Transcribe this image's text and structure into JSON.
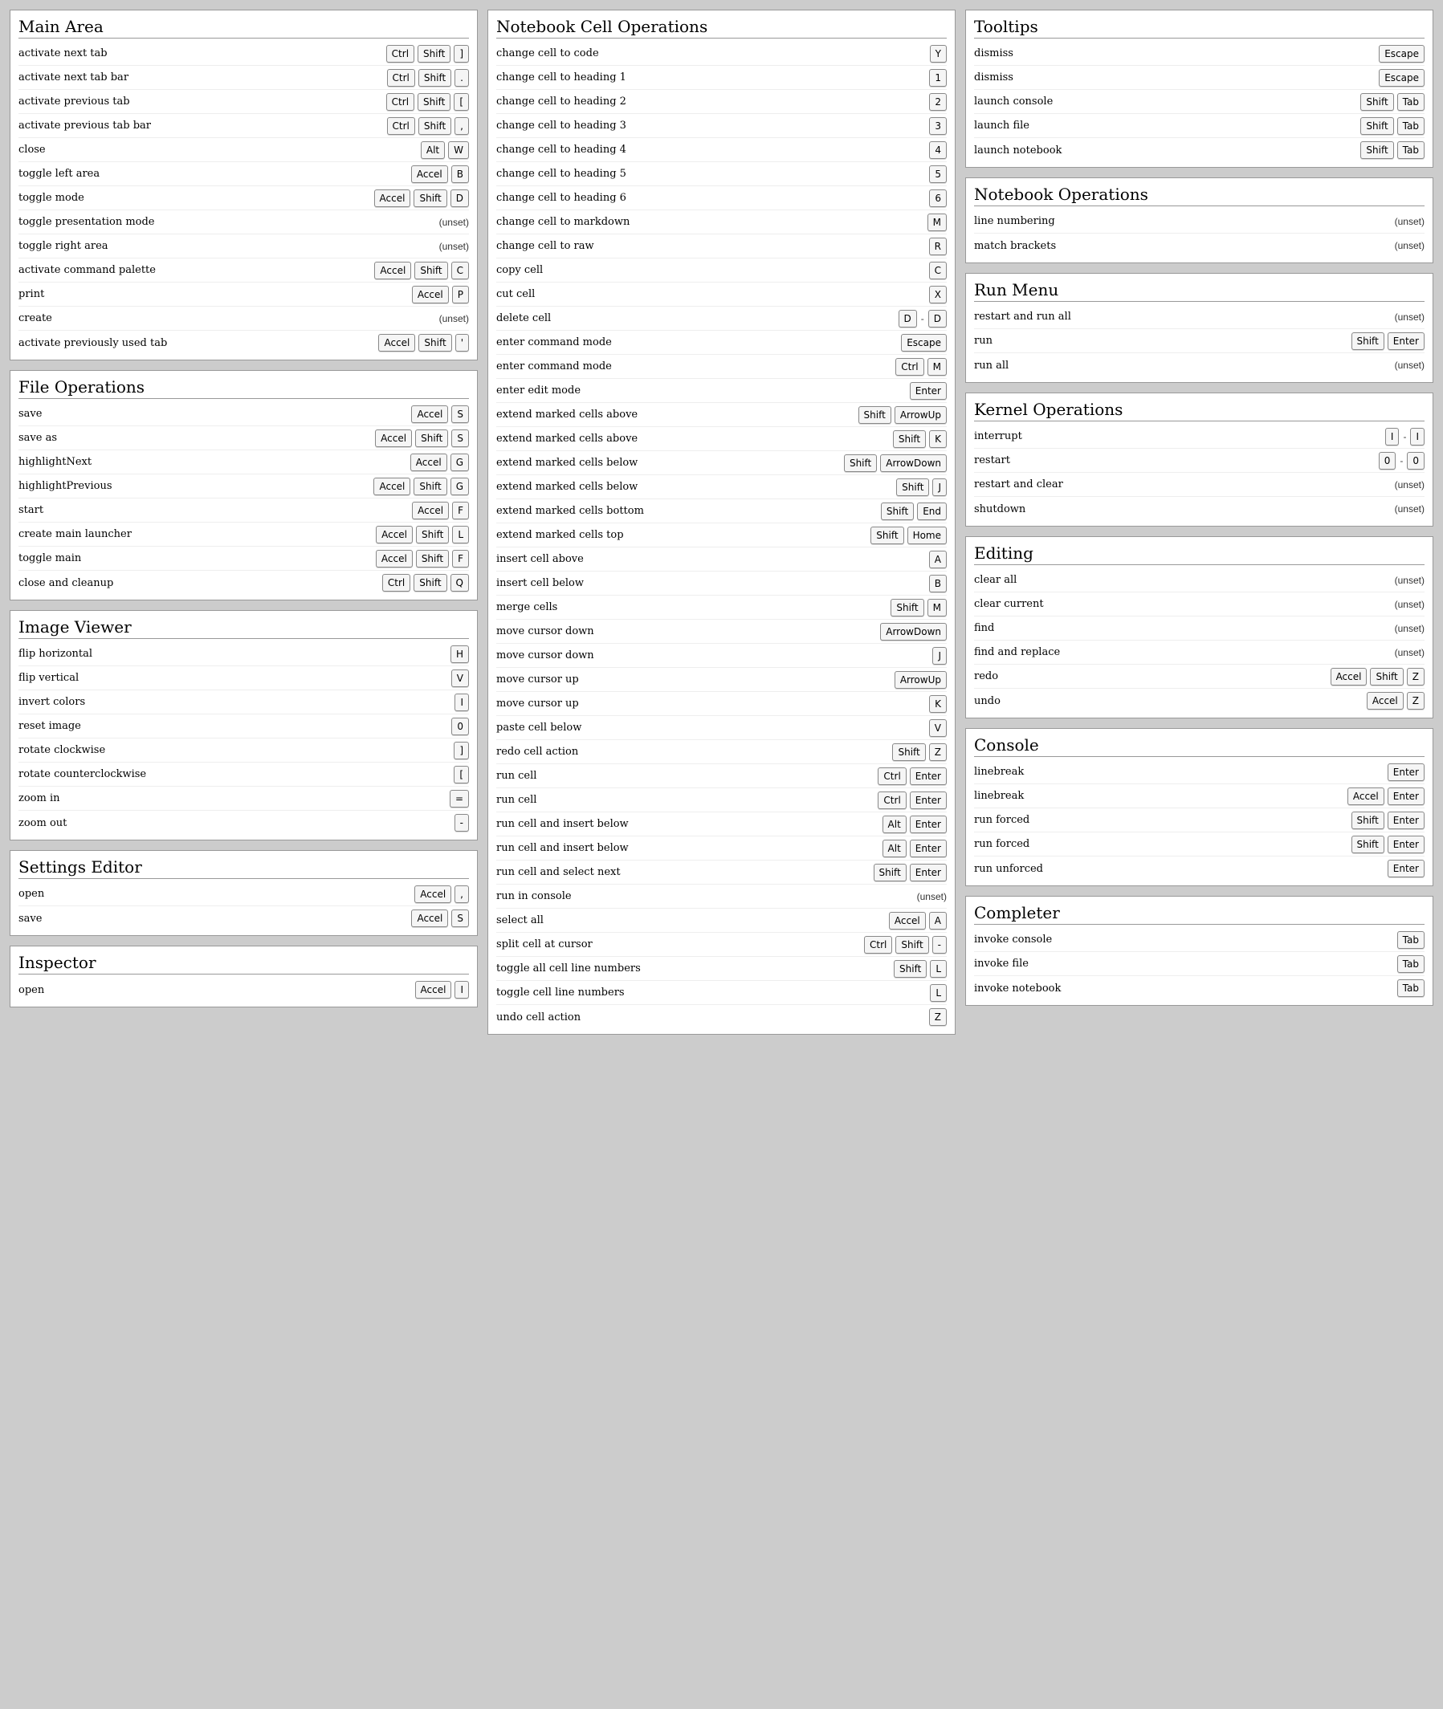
{
  "unset_label": "(unset)",
  "columns": [
    [
      {
        "title": "Main Area",
        "rows": [
          {
            "label": "activate next tab",
            "keys": [
              [
                "Ctrl",
                "Shift",
                "]"
              ]
            ]
          },
          {
            "label": "activate next tab bar",
            "keys": [
              [
                "Ctrl",
                "Shift",
                "."
              ]
            ]
          },
          {
            "label": "activate previous tab",
            "keys": [
              [
                "Ctrl",
                "Shift",
                "["
              ]
            ]
          },
          {
            "label": "activate previous tab bar",
            "keys": [
              [
                "Ctrl",
                "Shift",
                ","
              ]
            ]
          },
          {
            "label": "close",
            "keys": [
              [
                "Alt",
                "W"
              ]
            ]
          },
          {
            "label": "toggle left area",
            "keys": [
              [
                "Accel",
                "B"
              ]
            ]
          },
          {
            "label": "toggle mode",
            "keys": [
              [
                "Accel",
                "Shift",
                "D"
              ]
            ]
          },
          {
            "label": "toggle presentation mode",
            "unset": true
          },
          {
            "label": "toggle right area",
            "unset": true
          },
          {
            "label": "activate command palette",
            "keys": [
              [
                "Accel",
                "Shift",
                "C"
              ]
            ]
          },
          {
            "label": "print",
            "keys": [
              [
                "Accel",
                "P"
              ]
            ]
          },
          {
            "label": "create",
            "unset": true
          },
          {
            "label": "activate previously used tab",
            "keys": [
              [
                "Accel",
                "Shift",
                "'"
              ]
            ]
          }
        ]
      },
      {
        "title": "File Operations",
        "rows": [
          {
            "label": "save",
            "keys": [
              [
                "Accel",
                "S"
              ]
            ]
          },
          {
            "label": "save as",
            "keys": [
              [
                "Accel",
                "Shift",
                "S"
              ]
            ]
          },
          {
            "label": "highlightNext",
            "keys": [
              [
                "Accel",
                "G"
              ]
            ]
          },
          {
            "label": "highlightPrevious",
            "keys": [
              [
                "Accel",
                "Shift",
                "G"
              ]
            ]
          },
          {
            "label": "start",
            "keys": [
              [
                "Accel",
                "F"
              ]
            ]
          },
          {
            "label": "create main launcher",
            "keys": [
              [
                "Accel",
                "Shift",
                "L"
              ]
            ]
          },
          {
            "label": "toggle main",
            "keys": [
              [
                "Accel",
                "Shift",
                "F"
              ]
            ]
          },
          {
            "label": "close and cleanup",
            "keys": [
              [
                "Ctrl",
                "Shift",
                "Q"
              ]
            ]
          }
        ]
      },
      {
        "title": "Image Viewer",
        "rows": [
          {
            "label": "flip horizontal",
            "keys": [
              [
                "H"
              ]
            ]
          },
          {
            "label": "flip vertical",
            "keys": [
              [
                "V"
              ]
            ]
          },
          {
            "label": "invert colors",
            "keys": [
              [
                "I"
              ]
            ]
          },
          {
            "label": "reset image",
            "keys": [
              [
                "0"
              ]
            ]
          },
          {
            "label": "rotate clockwise",
            "keys": [
              [
                "]"
              ]
            ]
          },
          {
            "label": "rotate counterclockwise",
            "keys": [
              [
                "["
              ]
            ]
          },
          {
            "label": "zoom in",
            "keys": [
              [
                "="
              ]
            ]
          },
          {
            "label": "zoom out",
            "keys": [
              [
                "-"
              ]
            ]
          }
        ]
      },
      {
        "title": "Settings Editor",
        "rows": [
          {
            "label": "open",
            "keys": [
              [
                "Accel",
                ","
              ]
            ]
          },
          {
            "label": "save",
            "keys": [
              [
                "Accel",
                "S"
              ]
            ]
          }
        ]
      },
      {
        "title": "Inspector",
        "rows": [
          {
            "label": "open",
            "keys": [
              [
                "Accel",
                "I"
              ]
            ]
          }
        ]
      }
    ],
    [
      {
        "title": "Notebook Cell Operations",
        "rows": [
          {
            "label": "change cell to code",
            "keys": [
              [
                "Y"
              ]
            ]
          },
          {
            "label": "change cell to heading 1",
            "keys": [
              [
                "1"
              ]
            ]
          },
          {
            "label": "change cell to heading 2",
            "keys": [
              [
                "2"
              ]
            ]
          },
          {
            "label": "change cell to heading 3",
            "keys": [
              [
                "3"
              ]
            ]
          },
          {
            "label": "change cell to heading 4",
            "keys": [
              [
                "4"
              ]
            ]
          },
          {
            "label": "change cell to heading 5",
            "keys": [
              [
                "5"
              ]
            ]
          },
          {
            "label": "change cell to heading 6",
            "keys": [
              [
                "6"
              ]
            ]
          },
          {
            "label": "change cell to markdown",
            "keys": [
              [
                "M"
              ]
            ]
          },
          {
            "label": "change cell to raw",
            "keys": [
              [
                "R"
              ]
            ]
          },
          {
            "label": "copy cell",
            "keys": [
              [
                "C"
              ]
            ]
          },
          {
            "label": "cut cell",
            "keys": [
              [
                "X"
              ]
            ]
          },
          {
            "label": "delete cell",
            "keys": [
              [
                "D"
              ],
              [
                "D"
              ]
            ]
          },
          {
            "label": "enter command mode",
            "keys": [
              [
                "Escape"
              ]
            ]
          },
          {
            "label": "enter command mode",
            "keys": [
              [
                "Ctrl",
                "M"
              ]
            ]
          },
          {
            "label": "enter edit mode",
            "keys": [
              [
                "Enter"
              ]
            ]
          },
          {
            "label": "extend marked cells above",
            "keys": [
              [
                "Shift",
                "ArrowUp"
              ]
            ]
          },
          {
            "label": "extend marked cells above",
            "keys": [
              [
                "Shift",
                "K"
              ]
            ]
          },
          {
            "label": "extend marked cells below",
            "keys": [
              [
                "Shift",
                "ArrowDown"
              ]
            ]
          },
          {
            "label": "extend marked cells below",
            "keys": [
              [
                "Shift",
                "J"
              ]
            ]
          },
          {
            "label": "extend marked cells bottom",
            "keys": [
              [
                "Shift",
                "End"
              ]
            ]
          },
          {
            "label": "extend marked cells top",
            "keys": [
              [
                "Shift",
                "Home"
              ]
            ]
          },
          {
            "label": "insert cell above",
            "keys": [
              [
                "A"
              ]
            ]
          },
          {
            "label": "insert cell below",
            "keys": [
              [
                "B"
              ]
            ]
          },
          {
            "label": "merge cells",
            "keys": [
              [
                "Shift",
                "M"
              ]
            ]
          },
          {
            "label": "move cursor down",
            "keys": [
              [
                "ArrowDown"
              ]
            ]
          },
          {
            "label": "move cursor down",
            "keys": [
              [
                "J"
              ]
            ]
          },
          {
            "label": "move cursor up",
            "keys": [
              [
                "ArrowUp"
              ]
            ]
          },
          {
            "label": "move cursor up",
            "keys": [
              [
                "K"
              ]
            ]
          },
          {
            "label": "paste cell below",
            "keys": [
              [
                "V"
              ]
            ]
          },
          {
            "label": "redo cell action",
            "keys": [
              [
                "Shift",
                "Z"
              ]
            ]
          },
          {
            "label": "run cell",
            "keys": [
              [
                "Ctrl",
                "Enter"
              ]
            ]
          },
          {
            "label": "run cell",
            "keys": [
              [
                "Ctrl",
                "Enter"
              ]
            ]
          },
          {
            "label": "run cell and insert below",
            "keys": [
              [
                "Alt",
                "Enter"
              ]
            ]
          },
          {
            "label": "run cell and insert below",
            "keys": [
              [
                "Alt",
                "Enter"
              ]
            ]
          },
          {
            "label": "run cell and select next",
            "keys": [
              [
                "Shift",
                "Enter"
              ]
            ]
          },
          {
            "label": "run in console",
            "unset": true
          },
          {
            "label": "select all",
            "keys": [
              [
                "Accel",
                "A"
              ]
            ]
          },
          {
            "label": "split cell at cursor",
            "keys": [
              [
                "Ctrl",
                "Shift",
                "-"
              ]
            ]
          },
          {
            "label": "toggle all cell line numbers",
            "keys": [
              [
                "Shift",
                "L"
              ]
            ]
          },
          {
            "label": "toggle cell line numbers",
            "keys": [
              [
                "L"
              ]
            ]
          },
          {
            "label": "undo cell action",
            "keys": [
              [
                "Z"
              ]
            ]
          }
        ]
      }
    ],
    [
      {
        "title": "Tooltips",
        "rows": [
          {
            "label": "dismiss",
            "keys": [
              [
                "Escape"
              ]
            ]
          },
          {
            "label": "dismiss",
            "keys": [
              [
                "Escape"
              ]
            ]
          },
          {
            "label": "launch console",
            "keys": [
              [
                "Shift",
                "Tab"
              ]
            ]
          },
          {
            "label": "launch file",
            "keys": [
              [
                "Shift",
                "Tab"
              ]
            ]
          },
          {
            "label": "launch notebook",
            "keys": [
              [
                "Shift",
                "Tab"
              ]
            ]
          }
        ]
      },
      {
        "title": "Notebook Operations",
        "rows": [
          {
            "label": "line numbering",
            "unset": true
          },
          {
            "label": "match brackets",
            "unset": true
          }
        ]
      },
      {
        "title": "Run Menu",
        "rows": [
          {
            "label": "restart and run all",
            "unset": true
          },
          {
            "label": "run",
            "keys": [
              [
                "Shift",
                "Enter"
              ]
            ]
          },
          {
            "label": "run all",
            "unset": true
          }
        ]
      },
      {
        "title": "Kernel Operations",
        "rows": [
          {
            "label": "interrupt",
            "keys": [
              [
                "I"
              ],
              [
                "I"
              ]
            ]
          },
          {
            "label": "restart",
            "keys": [
              [
                "0"
              ],
              [
                "0"
              ]
            ]
          },
          {
            "label": "restart and clear",
            "unset": true
          },
          {
            "label": "shutdown",
            "unset": true
          }
        ]
      },
      {
        "title": "Editing",
        "rows": [
          {
            "label": "clear all",
            "unset": true
          },
          {
            "label": "clear current",
            "unset": true
          },
          {
            "label": "find",
            "unset": true
          },
          {
            "label": "find and replace",
            "unset": true
          },
          {
            "label": "redo",
            "keys": [
              [
                "Accel",
                "Shift",
                "Z"
              ]
            ]
          },
          {
            "label": "undo",
            "keys": [
              [
                "Accel",
                "Z"
              ]
            ]
          }
        ]
      },
      {
        "title": "Console",
        "rows": [
          {
            "label": "linebreak",
            "keys": [
              [
                "Enter"
              ]
            ]
          },
          {
            "label": "linebreak",
            "keys": [
              [
                "Accel",
                "Enter"
              ]
            ]
          },
          {
            "label": "run forced",
            "keys": [
              [
                "Shift",
                "Enter"
              ]
            ]
          },
          {
            "label": "run forced",
            "keys": [
              [
                "Shift",
                "Enter"
              ]
            ]
          },
          {
            "label": "run unforced",
            "keys": [
              [
                "Enter"
              ]
            ]
          }
        ]
      },
      {
        "title": "Completer",
        "rows": [
          {
            "label": "invoke console",
            "keys": [
              [
                "Tab"
              ]
            ]
          },
          {
            "label": "invoke file",
            "keys": [
              [
                "Tab"
              ]
            ]
          },
          {
            "label": "invoke notebook",
            "keys": [
              [
                "Tab"
              ]
            ]
          }
        ]
      }
    ]
  ]
}
